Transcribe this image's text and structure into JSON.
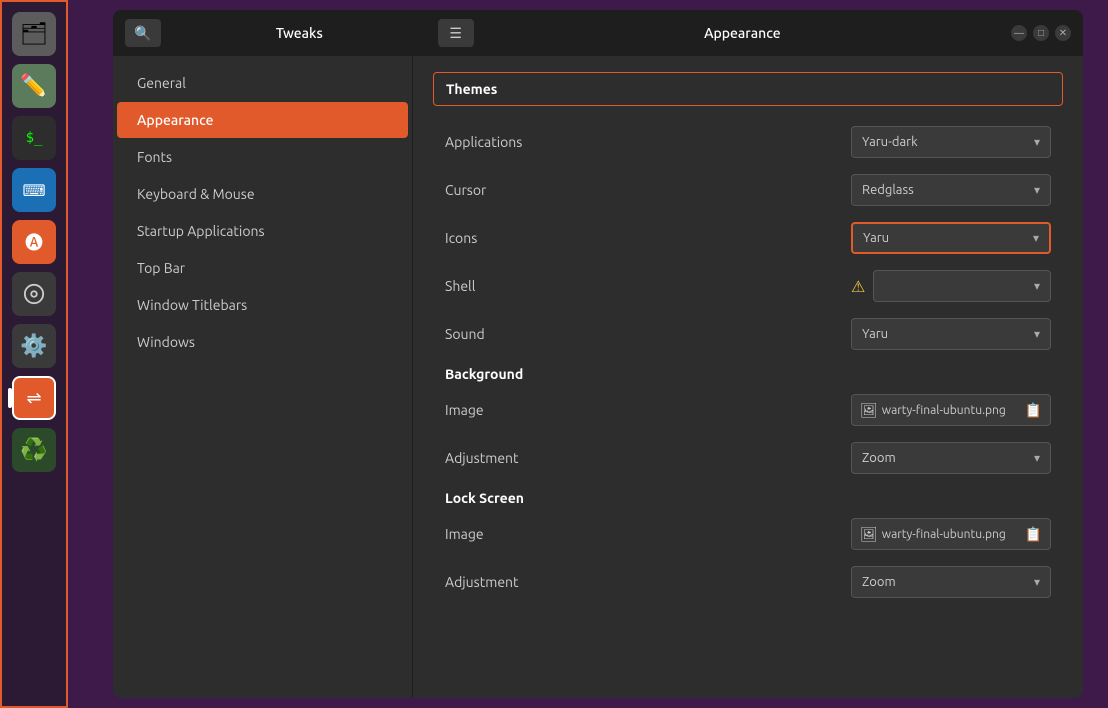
{
  "taskbar": {
    "icons": [
      {
        "name": "files",
        "label": "Files",
        "symbol": "🗂",
        "class": "files",
        "active": false
      },
      {
        "name": "editor",
        "label": "Text Editor",
        "symbol": "✏",
        "class": "editor",
        "active": false
      },
      {
        "name": "terminal",
        "label": "Terminal",
        "symbol": ">_",
        "class": "terminal",
        "active": false
      },
      {
        "name": "vscode",
        "label": "VS Code",
        "symbol": "⟨⟩",
        "class": "vscode",
        "active": false
      },
      {
        "name": "appstore",
        "label": "App Store",
        "symbol": "🅐",
        "class": "appstore",
        "active": false
      },
      {
        "name": "disk",
        "label": "Disk",
        "symbol": "⊙",
        "class": "disk",
        "active": false
      },
      {
        "name": "settings",
        "label": "Settings",
        "symbol": "⚙",
        "class": "settings",
        "active": false
      },
      {
        "name": "tweaks",
        "label": "Tweaks",
        "symbol": "⇌",
        "class": "tweaks",
        "active": true
      },
      {
        "name": "trash",
        "label": "Trash",
        "symbol": "♻",
        "class": "trash",
        "active": false
      }
    ]
  },
  "window": {
    "left_title": "Tweaks",
    "right_title": "Appearance",
    "minimize_label": "—",
    "maximize_label": "□",
    "close_label": "✕"
  },
  "sidebar": {
    "items": [
      {
        "label": "General",
        "active": false
      },
      {
        "label": "Appearance",
        "active": true
      },
      {
        "label": "Fonts",
        "active": false
      },
      {
        "label": "Keyboard & Mouse",
        "active": false
      },
      {
        "label": "Startup Applications",
        "active": false
      },
      {
        "label": "Top Bar",
        "active": false
      },
      {
        "label": "Window Titlebars",
        "active": false
      },
      {
        "label": "Windows",
        "active": false
      }
    ]
  },
  "main": {
    "themes_section": {
      "label": "Themes",
      "rows": [
        {
          "label": "Applications",
          "value": "Yaru-dark",
          "type": "dropdown",
          "highlighted": false
        },
        {
          "label": "Cursor",
          "value": "Redglass",
          "type": "dropdown",
          "highlighted": false
        },
        {
          "label": "Icons",
          "value": "Yaru",
          "type": "dropdown",
          "highlighted": true
        },
        {
          "label": "Sound",
          "value": "Yaru",
          "type": "dropdown",
          "highlighted": false
        }
      ],
      "shell_label": "Shell",
      "shell_warning": "⚠"
    },
    "background_section": {
      "label": "Background",
      "image_label": "Image",
      "image_value": "warty-final-ubuntu.png",
      "adjustment_label": "Adjustment",
      "adjustment_value": "Zoom"
    },
    "lock_screen_section": {
      "label": "Lock Screen",
      "image_label": "Image",
      "image_value": "warty-final-ubuntu.png",
      "adjustment_label": "Adjustment",
      "adjustment_value": "Zoom"
    }
  }
}
